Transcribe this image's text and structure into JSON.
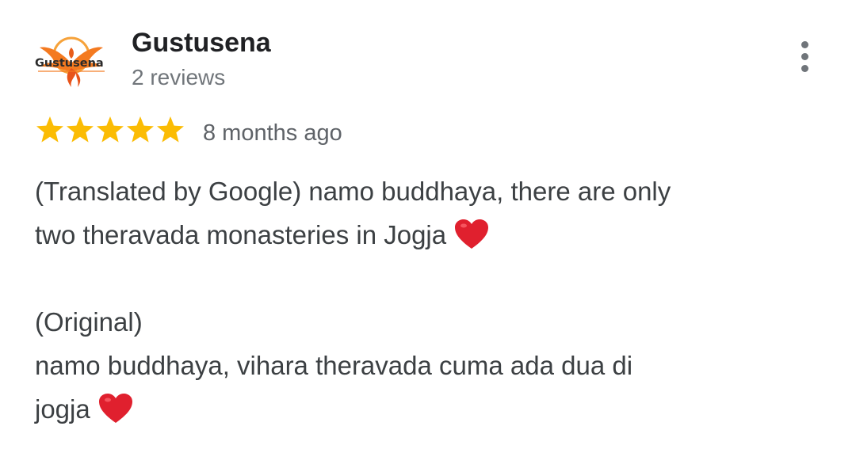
{
  "reviewer": {
    "name": "Gustusena",
    "review_count": "2 reviews",
    "avatar_logo_text": "Gustusena"
  },
  "menu": {
    "icon": "more-vert-icon"
  },
  "rating": {
    "stars": 5,
    "max_stars": 5,
    "star_color": "#fbbc04",
    "time": "8 months ago"
  },
  "review": {
    "translated_line1": "(Translated by Google) namo buddhaya, there are only",
    "translated_line2": "two theravada monasteries in Jogja",
    "original_label": "(Original)",
    "original_line1": "namo buddhaya, vihara theravada cuma ada dua di",
    "original_line2": "jogja",
    "emoji": "red-heart-emoji"
  },
  "colors": {
    "name": "#202124",
    "secondary_text": "#70757a",
    "body_text": "#3c4043",
    "heart": "#e0202e",
    "logo_orange": "#f47a20"
  }
}
